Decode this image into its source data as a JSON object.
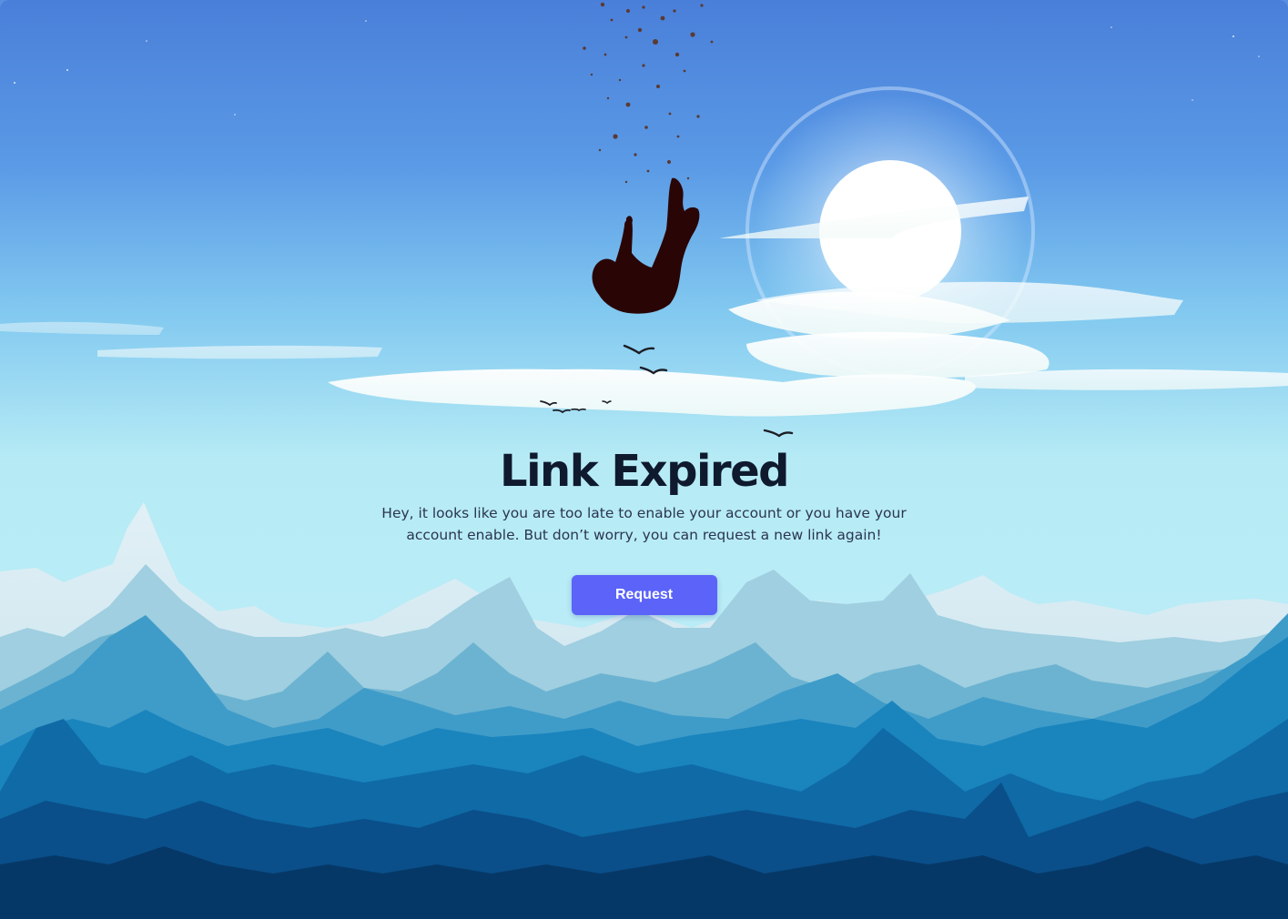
{
  "error": {
    "title": "Link Expired",
    "message": "Hey, it looks like you are too late to enable your account or you have your account enable. But don’t worry, you can request a new link again!",
    "button_label": "Request"
  },
  "colors": {
    "button": "#5b63f8",
    "title": "#0f1a2e",
    "sky_top": "#4a7fd9",
    "sky_bottom": "#b6ebf5",
    "mountains_dark": "#0b3a6e"
  },
  "illustration": {
    "icons": [
      "falling-person-icon",
      "bird-icon",
      "sun-icon",
      "cloud-icon",
      "mountain-icon"
    ]
  }
}
